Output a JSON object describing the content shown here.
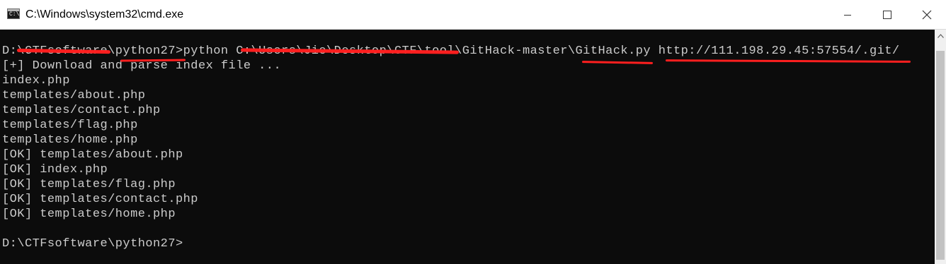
{
  "window": {
    "title": "C:\\Windows\\system32\\cmd.exe",
    "icon": "cmd-icon",
    "icon_glyph": "C:\\",
    "controls": {
      "minimize": "minimize-icon",
      "maximize": "maximize-icon",
      "close": "close-icon"
    }
  },
  "console": {
    "background": "#0c0c0c",
    "text_color": "#cccccc",
    "annotation_color": "#ff1f1f",
    "command_line": {
      "prompt": "D:\\CTFsoftware\\python27>",
      "command": "python C:\\Users\\Jie\\Desktop\\CTF\\tool\\GitHack-master\\GitHack.py http://111.198.29.45:57554/.git/"
    },
    "output": [
      "[+] Download and parse index file ...",
      "index.php",
      "templates/about.php",
      "templates/contact.php",
      "templates/flag.php",
      "templates/home.php",
      "[OK] templates/about.php",
      "[OK] index.php",
      "[OK] templates/flag.php",
      "[OK] templates/contact.php",
      "[OK] templates/home.php",
      "",
      "D:\\CTFsoftware\\python27>"
    ]
  }
}
